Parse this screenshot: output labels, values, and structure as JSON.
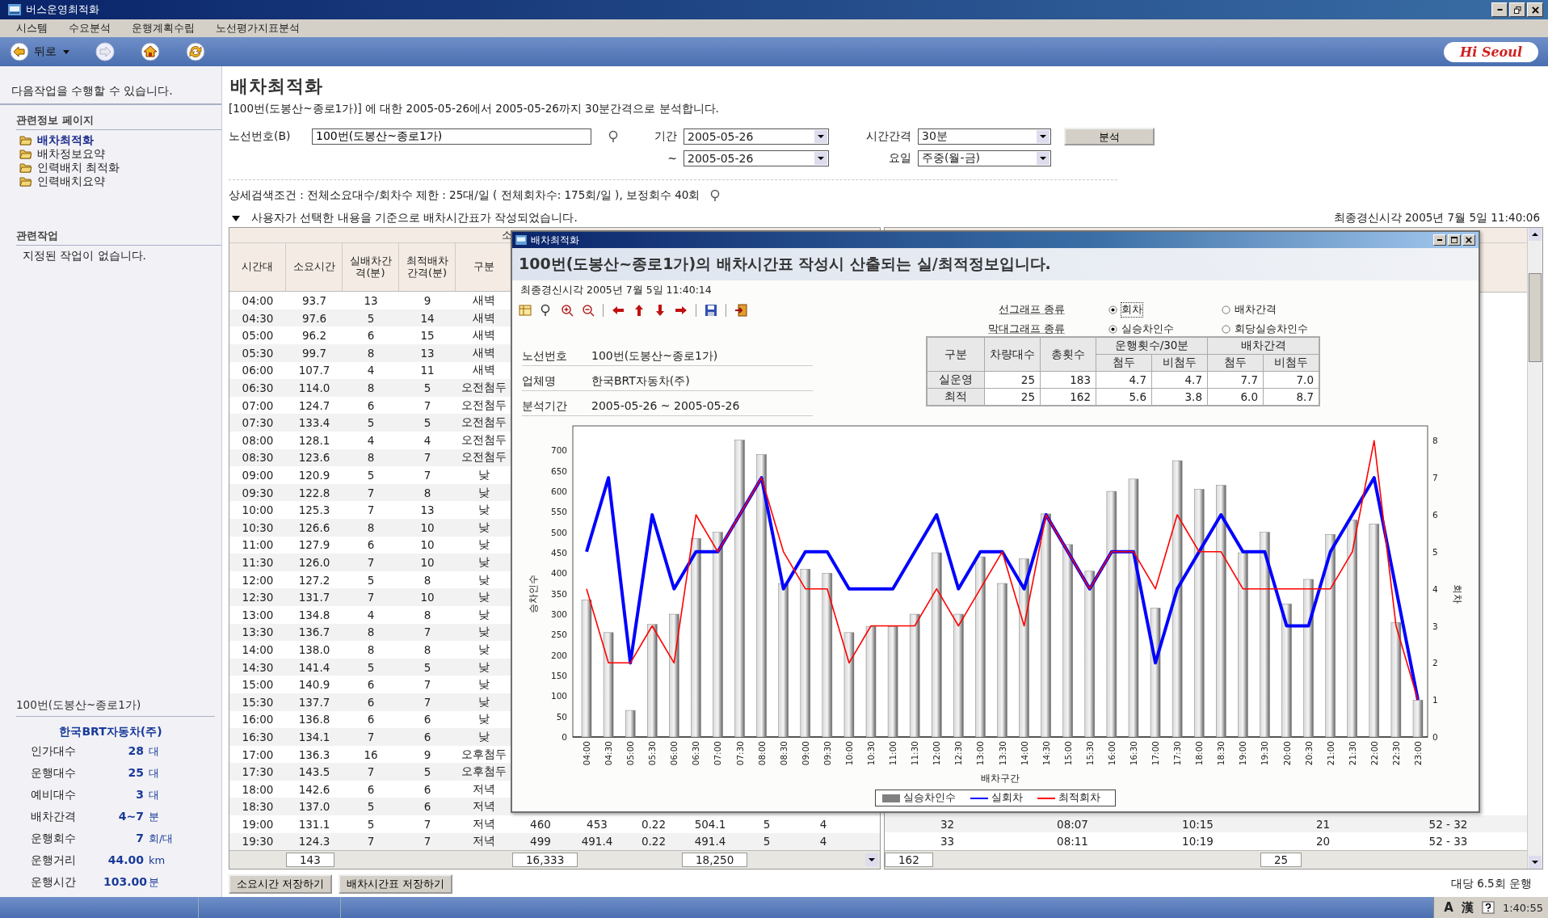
{
  "window": {
    "title": "버스운영최적화"
  },
  "menu": [
    "시스템",
    "수요분석",
    "운행계획수립",
    "노선평가지표분석"
  ],
  "toolbar": {
    "back_label": "뒤로",
    "logo": "Hi Seoul"
  },
  "sidebar": {
    "intro": "다음작업을 수행할 수 있습니다.",
    "info_title": "관련정보 페이지",
    "info_items": [
      {
        "label": "배차최적화",
        "selected": true
      },
      {
        "label": "배차정보요약",
        "selected": false
      },
      {
        "label": "인력배치 최적화",
        "selected": false
      },
      {
        "label": "인력배치요약",
        "selected": false
      }
    ],
    "tasks_title": "관련작업",
    "tasks_empty": "지정된 작업이 없습니다.",
    "route": "100번(도봉산~종로1가)",
    "company": "한국BRT자동차(주)",
    "stats": [
      {
        "label": "인가대수",
        "value": "28",
        "unit": "대"
      },
      {
        "label": "운행대수",
        "value": "25",
        "unit": "대"
      },
      {
        "label": "예비대수",
        "value": "3",
        "unit": "대"
      },
      {
        "label": "배차간격",
        "value": "4~7",
        "unit": "분"
      },
      {
        "label": "운행회수",
        "value": "7",
        "unit": "회/대"
      },
      {
        "label": "운행거리",
        "value": "44.00",
        "unit": "km"
      },
      {
        "label": "운행시간",
        "value": "103.00",
        "unit": "분"
      }
    ]
  },
  "page": {
    "title": "배차최적화",
    "description": "[100번(도봉산~종로1가)] 에 대한 2005-05-26에서 2005-05-26까지 30분간격으로 분석합니다.",
    "filters": {
      "route_label": "노선번호(B)",
      "route_value": "100번(도봉산~종로1가)",
      "period_label": "기간",
      "date_from": "2005-05-26",
      "tilde": "~",
      "date_to": "2005-05-26",
      "interval_label": "시간간격",
      "interval_value": "30분",
      "day_label": "요일",
      "day_value": "주중(월-금)",
      "analyze_button": "분석"
    },
    "conditions": "상세검색조건 : 전체소요대수/회차수 제한 : 25대/일 ( 전체회차수: 175회/일 ), 보정회수 40회",
    "notice": "사용자가 선택한 내용을 기준으로 배차시간표가 작성되었습니다.",
    "last_updated": "최종경신시각 2005년 7월 5일 11:40:06"
  },
  "schedule_table": {
    "group_header": "소",
    "columns": [
      "시간대",
      "소요시간",
      "실배차간격(분)",
      "최적배차간격(분)",
      "구분"
    ],
    "rows": [
      [
        "04:00",
        "93.7",
        "13",
        "9",
        "새벽"
      ],
      [
        "04:30",
        "97.6",
        "5",
        "14",
        "새벽"
      ],
      [
        "05:00",
        "96.2",
        "6",
        "15",
        "새벽"
      ],
      [
        "05:30",
        "99.7",
        "8",
        "13",
        "새벽"
      ],
      [
        "06:00",
        "107.7",
        "4",
        "11",
        "새벽"
      ],
      [
        "06:30",
        "114.0",
        "8",
        "5",
        "오전첨두"
      ],
      [
        "07:00",
        "124.7",
        "6",
        "7",
        "오전첨두"
      ],
      [
        "07:30",
        "133.4",
        "5",
        "5",
        "오전첨두"
      ],
      [
        "08:00",
        "128.1",
        "4",
        "4",
        "오전첨두"
      ],
      [
        "08:30",
        "123.6",
        "8",
        "7",
        "오전첨두"
      ],
      [
        "09:00",
        "120.9",
        "5",
        "7",
        "낮"
      ],
      [
        "09:30",
        "122.8",
        "7",
        "8",
        "낮"
      ],
      [
        "10:00",
        "125.3",
        "7",
        "13",
        "낮"
      ],
      [
        "10:30",
        "126.6",
        "8",
        "10",
        "낮"
      ],
      [
        "11:00",
        "127.9",
        "6",
        "10",
        "낮"
      ],
      [
        "11:30",
        "126.0",
        "7",
        "10",
        "낮"
      ],
      [
        "12:00",
        "127.2",
        "5",
        "8",
        "낮"
      ],
      [
        "12:30",
        "131.7",
        "7",
        "10",
        "낮"
      ],
      [
        "13:00",
        "134.8",
        "4",
        "8",
        "낮"
      ],
      [
        "13:30",
        "136.7",
        "8",
        "7",
        "낮"
      ],
      [
        "14:00",
        "138.0",
        "8",
        "8",
        "낮"
      ],
      [
        "14:30",
        "141.4",
        "5",
        "5",
        "낮"
      ],
      [
        "15:00",
        "140.9",
        "6",
        "7",
        "낮"
      ],
      [
        "15:30",
        "137.7",
        "6",
        "7",
        "낮"
      ],
      [
        "16:00",
        "136.8",
        "6",
        "6",
        "낮"
      ],
      [
        "16:30",
        "134.1",
        "7",
        "6",
        "낮"
      ],
      [
        "17:00",
        "136.3",
        "16",
        "9",
        "오후첨두"
      ],
      [
        "17:30",
        "143.5",
        "7",
        "5",
        "오후첨두"
      ],
      [
        "18:00",
        "142.6",
        "6",
        "6",
        "저녁"
      ],
      [
        "18:30",
        "137.0",
        "5",
        "6",
        "저녁"
      ],
      [
        "19:00",
        "131.1",
        "5",
        "7",
        "저녁",
        "460",
        "453",
        "0.22",
        "504.1",
        "5",
        "4"
      ],
      [
        "19:30",
        "124.3",
        "7",
        "7",
        "저녁",
        "499",
        "491.4",
        "0.22",
        "491.4",
        "5",
        "4"
      ]
    ],
    "totals": {
      "column_2": "143",
      "column_6": "16,333",
      "column_9": "18,250"
    }
  },
  "crew_table": {
    "rows": [
      [
        "32",
        "08:07",
        "10:15",
        "21",
        "52 - 32"
      ],
      [
        "33",
        "08:11",
        "10:19",
        "20",
        "52 - 33"
      ]
    ],
    "totals": {
      "column_1": "162",
      "column_4": "25"
    }
  },
  "buttons": [
    "소요시간 저장하기",
    "배차시간표 저장하기"
  ],
  "per_bus_note": "대당 6.5회 운행",
  "dialog": {
    "title": "배차최적화",
    "heading": "100번(도봉산~종로1가)의 배차시간표 작성시 산출되는 실/최적정보입니다.",
    "last_updated": "최종경신시각 2005년 7월 5일 11:40:14",
    "graph_options": [
      {
        "label": "선그래프 종류",
        "options": [
          {
            "label": "회차",
            "selected": true
          },
          {
            "label": "배차간격",
            "selected": false
          }
        ]
      },
      {
        "label": "막대그래프 종류",
        "options": [
          {
            "label": "실승차인수",
            "selected": true
          },
          {
            "label": "회당실승차인수",
            "selected": false
          }
        ]
      }
    ],
    "info": [
      {
        "label": "노선번호",
        "value": "100번(도봉산~종로1가)"
      },
      {
        "label": "업체명",
        "value": "한국BRT자동차(주)"
      },
      {
        "label": "분석기간",
        "value": "2005-05-26 ~ 2005-05-26"
      }
    ],
    "summary": {
      "headers": [
        "구분",
        "차량대수",
        "총횟수"
      ],
      "groups": [
        {
          "label": "운행횟수/30분",
          "subs": [
            "첨두",
            "비첨두"
          ]
        },
        {
          "label": "배차간격",
          "subs": [
            "첨두",
            "비첨두"
          ]
        }
      ],
      "rows": [
        [
          "실운영",
          "25",
          "183",
          "4.7",
          "4.7",
          "7.7",
          "7.0"
        ],
        [
          "최적",
          "25",
          "162",
          "5.6",
          "3.8",
          "6.0",
          "8.7"
        ]
      ]
    },
    "chart_data": {
      "type": "bar",
      "legend": "bottom",
      "xlabel": "배차구간",
      "ylabel": "승차인수",
      "y2label": "회차",
      "categories": [
        "04:00",
        "04:30",
        "05:00",
        "05:30",
        "06:00",
        "06:30",
        "07:00",
        "07:30",
        "08:00",
        "08:30",
        "09:00",
        "09:30",
        "10:00",
        "10:30",
        "11:00",
        "11:30",
        "12:00",
        "12:30",
        "13:00",
        "13:30",
        "14:00",
        "14:30",
        "15:00",
        "15:30",
        "16:00",
        "16:30",
        "17:00",
        "17:30",
        "18:00",
        "18:30",
        "19:00",
        "19:30",
        "20:00",
        "20:30",
        "21:00",
        "21:30",
        "22:00",
        "22:30",
        "23:00"
      ],
      "ylim": [
        0,
        760
      ],
      "yticks": [
        0,
        50,
        100,
        150,
        200,
        250,
        300,
        350,
        400,
        450,
        500,
        550,
        600,
        650,
        700
      ],
      "y2lim": [
        0,
        8.4
      ],
      "y2ticks": [
        0,
        1,
        2,
        3,
        4,
        5,
        6,
        7,
        8
      ],
      "series": [
        {
          "name": "실승차인수",
          "color": "#808080",
          "values": [
            335,
            255,
            65,
            275,
            300,
            485,
            500,
            725,
            690,
            375,
            410,
            400,
            255,
            270,
            270,
            300,
            450,
            300,
            440,
            375,
            435,
            545,
            470,
            405,
            600,
            630,
            315,
            675,
            605,
            615,
            450,
            500,
            325,
            385,
            495,
            530,
            520,
            280,
            90
          ]
        },
        {
          "name": "실회차",
          "type": "line",
          "axis": "y2",
          "color": "#0000ff",
          "values": [
            5,
            7,
            2,
            6,
            4,
            5,
            5,
            6,
            7,
            4,
            5,
            5,
            4,
            4,
            4,
            5,
            6,
            4,
            5,
            5,
            4,
            6,
            5,
            4,
            5,
            5,
            2,
            4,
            5,
            6,
            5,
            5,
            3,
            3,
            5,
            6,
            7,
            4,
            1
          ]
        },
        {
          "name": "최적회차",
          "type": "line",
          "axis": "y2",
          "color": "#ff0000",
          "values": [
            4,
            2,
            2,
            3,
            2,
            6,
            5,
            6,
            7,
            5,
            4,
            4,
            2,
            3,
            3,
            3,
            4,
            3,
            4,
            5,
            3,
            6,
            5,
            4,
            5,
            5,
            4,
            6,
            5,
            5,
            4,
            4,
            4,
            4,
            4,
            5,
            8,
            3,
            1
          ]
        }
      ]
    }
  },
  "status_bar": {
    "ime": [
      "A",
      "漢"
    ],
    "clock": "1:40:55"
  }
}
